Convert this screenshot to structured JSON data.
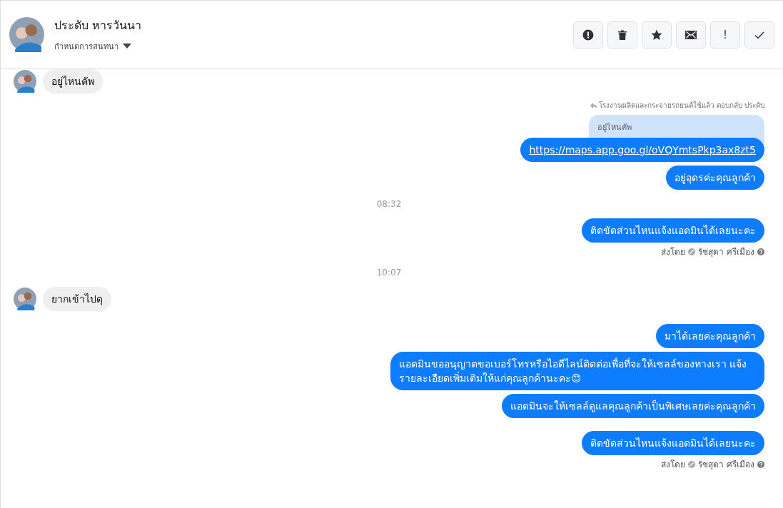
{
  "header": {
    "name": "ประดับ หารวันนา",
    "subtitle": "กำหนดการสนทนา",
    "actions": [
      {
        "kind": "alert"
      },
      {
        "kind": "trash"
      },
      {
        "kind": "star"
      },
      {
        "kind": "mail"
      },
      {
        "kind": "text",
        "label": "!"
      },
      {
        "kind": "check"
      }
    ]
  },
  "messages": [
    {
      "kind": "incoming",
      "text": "อยู่ไหนคัพ"
    },
    {
      "kind": "reply",
      "label": "โรงงานผลิตและกระจายรถยนต์ใช้แล้ว ตอบกลับ ประดับ",
      "quote": "อยู่ไหนคัพ",
      "link": "https://maps.app.goo.gl/oVQYmtsPkp3ax8zt5"
    },
    {
      "kind": "outgoing",
      "text": "อยู่อุดรค่ะคุณลูกค้า"
    },
    {
      "kind": "time",
      "text": "08:32"
    },
    {
      "kind": "outgoing",
      "text": "ติดขัดส่วนไหนแจ้งแอดมินได้เลยนะคะ"
    },
    {
      "kind": "sent",
      "prefix": "ส่งโดย",
      "agent": "รัชสุดา ศรีเมือง"
    },
    {
      "kind": "time",
      "text": "10:07"
    },
    {
      "kind": "incoming",
      "text": "ยากเข้าไปดุ"
    },
    {
      "kind": "gap"
    },
    {
      "kind": "outgoing",
      "text": "มาได้เลยค่ะคุณลูกค้า"
    },
    {
      "kind": "outgoing",
      "text": "แอดมินขออนุญาตขอเบอร์โทรหรือไอดีไลน์ติดต่อเพื่อที่จะให้เซลล์ของทางเรา แจ้งรายละเอียดเพิ่มเติมให้แก่คุณลูกค้านะคะ😊"
    },
    {
      "kind": "outgoing",
      "text": "แอดมินจะให้เซลล์ดูแลคุณลูกค้าเป็นพิเศษเลยค่ะคุณลูกค้า"
    },
    {
      "kind": "gap"
    },
    {
      "kind": "outgoing",
      "text": "ติดขัดส่วนไหนแจ้งแอดมินได้เลยนะคะ"
    },
    {
      "kind": "sent",
      "prefix": "ส่งโดย",
      "agent": "รัชสุดา ศรีเมือง"
    }
  ]
}
